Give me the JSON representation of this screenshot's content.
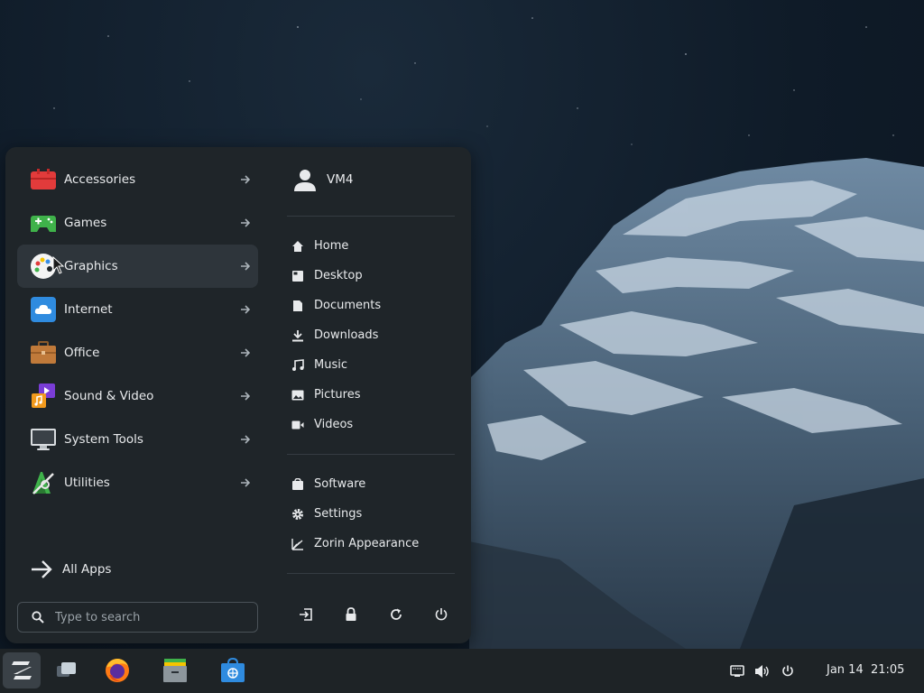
{
  "menu": {
    "categories": [
      {
        "label": "Accessories",
        "icon": "toolbox-icon"
      },
      {
        "label": "Games",
        "icon": "gamepad-icon"
      },
      {
        "label": "Graphics",
        "icon": "palette-icon"
      },
      {
        "label": "Internet",
        "icon": "cloud-icon"
      },
      {
        "label": "Office",
        "icon": "briefcase-icon"
      },
      {
        "label": "Sound & Video",
        "icon": "media-icon"
      },
      {
        "label": "System Tools",
        "icon": "monitor-icon"
      },
      {
        "label": "Utilities",
        "icon": "utilities-icon"
      }
    ],
    "active_category": "Graphics",
    "all_apps_label": "All Apps",
    "search_placeholder": "Type to search",
    "user_name": "VM4",
    "places": [
      {
        "label": "Home",
        "icon": "home-icon"
      },
      {
        "label": "Desktop",
        "icon": "desktop-icon"
      },
      {
        "label": "Documents",
        "icon": "document-icon"
      },
      {
        "label": "Downloads",
        "icon": "download-icon"
      },
      {
        "label": "Music",
        "icon": "music-icon"
      },
      {
        "label": "Pictures",
        "icon": "picture-icon"
      },
      {
        "label": "Videos",
        "icon": "video-icon"
      }
    ],
    "system": [
      {
        "label": "Software",
        "icon": "software-icon"
      },
      {
        "label": "Settings",
        "icon": "gear-icon"
      },
      {
        "label": "Zorin Appearance",
        "icon": "appearance-icon"
      }
    ],
    "power_buttons": [
      "logout-icon",
      "lock-icon",
      "restart-icon",
      "power-icon"
    ]
  },
  "taskbar": {
    "apps": [
      "zorin-menu-icon",
      "workspaces-icon",
      "firefox-icon",
      "files-icon",
      "software-store-icon"
    ],
    "tray": [
      "network-icon",
      "volume-icon",
      "power-icon"
    ],
    "date": "Jan 14",
    "time": "21:05"
  },
  "colors": {
    "menu_bg": "#1f2529",
    "active_bg": "#2e353b",
    "taskbar_bg": "#1e2326",
    "accent": "#2f8bdf"
  }
}
